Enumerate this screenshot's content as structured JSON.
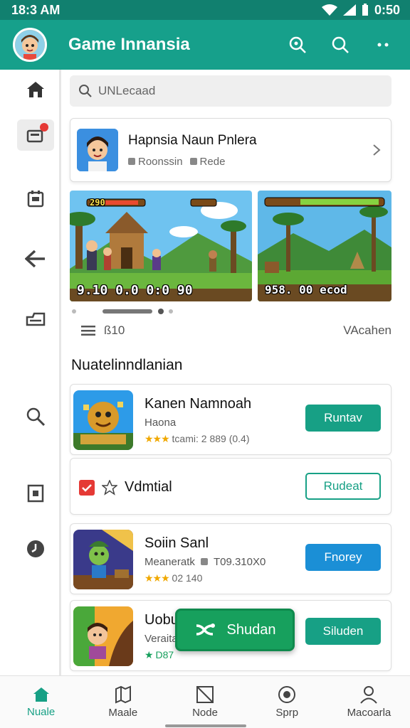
{
  "status_bar": {
    "time": "18:3 AM",
    "battery_time": "0:50"
  },
  "app_bar": {
    "title": "Game Innansia",
    "icons": [
      "game-search-icon",
      "search-icon",
      "more-icon"
    ]
  },
  "sidebar": {
    "icons": [
      "home-icon",
      "inbox-icon",
      "calendar-icon",
      "back-arrow-icon",
      "tray-icon",
      "search-icon",
      "image-icon",
      "clock-icon"
    ]
  },
  "search": {
    "placeholder": "UNLecaad"
  },
  "featured": {
    "title": "Hapnsia Naun Pnlera",
    "sub1": "Roonssin",
    "sub2": "Rede"
  },
  "screenshots": [
    {
      "hud_top": "290",
      "hud_bottom": "9.10  0.0  0:0 90"
    },
    {
      "hud_bottom": "958. 00 ecod"
    }
  ],
  "filter": {
    "label": "ß10",
    "right_label": "VAcahen"
  },
  "section_title": "Nuatelinndlanian",
  "apps": [
    {
      "title": "Kanen Namnoah",
      "sub": "Haona",
      "rating": "★★★",
      "meta": "tcami:  2 889 (0.4)",
      "button": "Runtav"
    },
    {
      "title": "Vdmtial",
      "button": "Rudeat"
    },
    {
      "title": "Soiin Sanl",
      "sub": "Meaneratk",
      "sub_meta": "T09.310X0",
      "rating": "★★★",
      "meta": "02 140",
      "button": "Fnorey"
    },
    {
      "title": "Uobu",
      "sub": "Veraita",
      "rating": "★",
      "meta": "D87",
      "button": "Siluden"
    }
  ],
  "fab": {
    "label": "Shudan"
  },
  "bottom_nav": [
    {
      "label": "Nuale",
      "icon": "home-icon"
    },
    {
      "label": "Maale",
      "icon": "map-icon"
    },
    {
      "label": "Node",
      "icon": "frame-icon"
    },
    {
      "label": "Sprp",
      "icon": "target-icon"
    },
    {
      "label": "Macoarla",
      "icon": "profile-icon"
    }
  ],
  "colors": {
    "primary": "#16a08b",
    "status": "#11806f",
    "blue_button": "#1b8fd6",
    "fab": "#17a05d",
    "badge": "#e53935",
    "stars": "#f0a800"
  }
}
